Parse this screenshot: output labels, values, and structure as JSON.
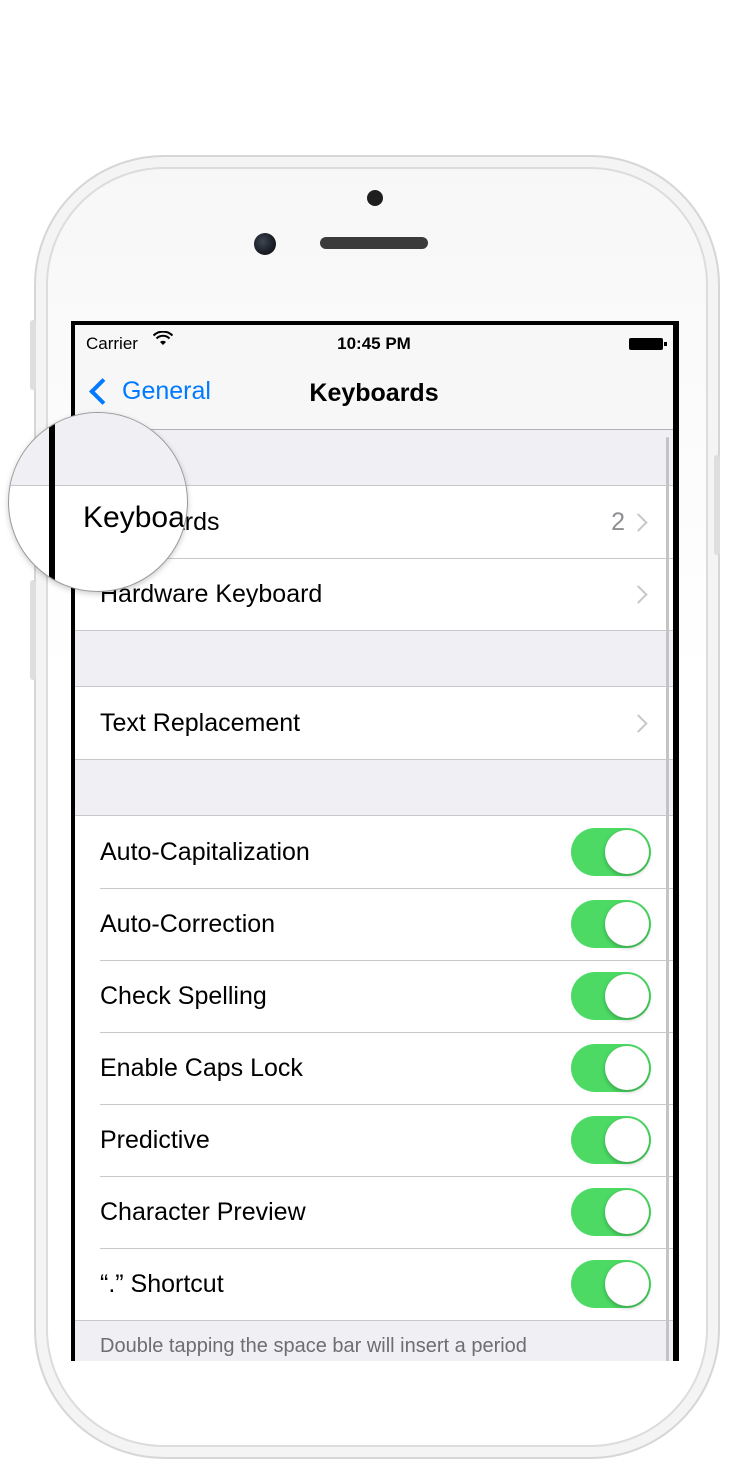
{
  "status_bar": {
    "carrier": "Carrier",
    "time": "10:45 PM"
  },
  "nav": {
    "back_label": "General",
    "title": "Keyboards"
  },
  "sections": [
    [
      {
        "label": "Keyboards",
        "value": "2",
        "type": "disclosure"
      },
      {
        "label": "Hardware Keyboard",
        "type": "disclosure"
      }
    ],
    [
      {
        "label": "Text Replacement",
        "type": "disclosure"
      }
    ],
    [
      {
        "label": "Auto-Capitalization",
        "type": "toggle",
        "on": true
      },
      {
        "label": "Auto-Correction",
        "type": "toggle",
        "on": true
      },
      {
        "label": "Check Spelling",
        "type": "toggle",
        "on": true
      },
      {
        "label": "Enable Caps Lock",
        "type": "toggle",
        "on": true
      },
      {
        "label": "Predictive",
        "type": "toggle",
        "on": true
      },
      {
        "label": "Character Preview",
        "type": "toggle",
        "on": true
      },
      {
        "label": "“.” Shortcut",
        "type": "toggle",
        "on": true
      }
    ]
  ],
  "footer": "Double tapping the space bar will insert a period",
  "loupe": {
    "text": "Keyboa"
  },
  "colors": {
    "accent": "#007aff",
    "toggle_on": "#4cd964",
    "group_bg": "#efeff4"
  }
}
